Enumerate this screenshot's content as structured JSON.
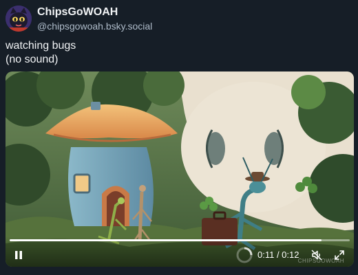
{
  "author": {
    "display_name": "ChipsGoWOAH",
    "handle": "@chipsgowoah.bsky.social",
    "avatar_icon": "cat-avatar-icon"
  },
  "post": {
    "text_lines": [
      "watching bugs",
      "(no sound)"
    ]
  },
  "video": {
    "current_time": "0:11",
    "duration": "0:12",
    "time_display": "0:11 / 0:12",
    "progress_fraction": 0.917,
    "watermark": "CHIPSGOWOAH",
    "controls": {
      "play_state_icon": "pause-icon",
      "mute_icon": "muted-speaker-icon",
      "fullscreen_icon": "fullscreen-icon",
      "loading_icon": "loading-spinner-icon"
    }
  },
  "colors": {
    "background": "#161e27",
    "text_primary": "#f1f3f5",
    "text_secondary": "#aebbc9"
  }
}
